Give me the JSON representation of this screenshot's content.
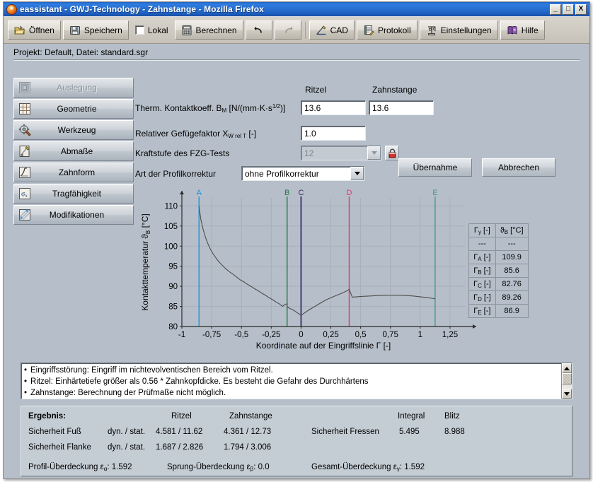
{
  "window": {
    "title": "eassistant - GWJ-Technology - Zahnstange - Mozilla Firefox",
    "app_icon": "firefox-icon",
    "minimize_label": "_",
    "maximize_label": "□",
    "close_label": "X"
  },
  "toolbar": {
    "items": [
      {
        "label": "Öffnen",
        "icon": "open-folder-icon"
      },
      {
        "label": "Speichern",
        "icon": "floppy-disk-icon"
      },
      {
        "label": "Lokal",
        "icon": "checkbox-icon",
        "checked": false
      },
      {
        "label": "Berechnen",
        "icon": "calculator-icon"
      },
      {
        "label": "",
        "icon": "undo-arrow-icon"
      },
      {
        "label": "",
        "icon": "redo-arrow-icon"
      },
      {
        "label": "CAD",
        "icon": "cad-pencil-icon"
      },
      {
        "label": "Protokoll",
        "icon": "report-icon"
      },
      {
        "label": "Einstellungen",
        "icon": "settings-tool-icon"
      },
      {
        "label": "Hilfe",
        "icon": "help-book-icon"
      }
    ]
  },
  "project_line": "Projekt: Default, Datei: standard.sgr",
  "sidebar": {
    "items": [
      {
        "label": "Auslegung",
        "icon": "layout-icon",
        "disabled": true
      },
      {
        "label": "Geometrie",
        "icon": "grid-icon",
        "disabled": false
      },
      {
        "label": "Werkzeug",
        "icon": "gear-tool-icon",
        "disabled": false
      },
      {
        "label": "Abmaße",
        "icon": "measure-icon",
        "disabled": false
      },
      {
        "label": "Zahnform",
        "icon": "tooth-profile-icon",
        "disabled": false
      },
      {
        "label": "Tragfähigkeit",
        "icon": "sigma-x-icon",
        "disabled": false
      },
      {
        "label": "Modifikationen",
        "icon": "modifications-icon",
        "disabled": false
      }
    ]
  },
  "form": {
    "col_headers": {
      "pinion": "Ritzel",
      "rack": "Zahnstange"
    },
    "rows": [
      {
        "label_main": "Therm. Kontaktkoeff. B",
        "label_sub": "M",
        "label_unit_pre": " [N/(mm·K·s",
        "label_sup": "1/2",
        "label_unit_post": ")]",
        "value_pinion": "13.6",
        "value_rack": "13.6"
      },
      {
        "label_main": "Relativer Gefügefaktor X",
        "label_sub": "W rel T",
        "label_unit_post": " [-]",
        "value_pinion": "1.0"
      },
      {
        "label_main": "Kraftstufe des FZG-Tests",
        "value_combo": "12",
        "disabled": true,
        "lock_icon": "padlock-icon"
      },
      {
        "label_main": "Art der Profilkorrektur",
        "value_combo": "ohne Profilkorrektur",
        "disabled": false
      }
    ],
    "buttons": {
      "apply": "Übernahme",
      "cancel": "Abbrechen"
    }
  },
  "chart_data": {
    "type": "line",
    "title": "",
    "xlabel": "Koordinate auf der Eingriffslinie Γ [-]",
    "ylabel": "Kontakttemperatur ϑ_B [°C]",
    "ylabel_main": "Kontakttemperatur ϑ",
    "ylabel_sub": "B",
    "ylabel_unit": " [°C]",
    "xlim": [
      -1,
      1.375
    ],
    "ylim": [
      80,
      112
    ],
    "xticks": [
      "-1",
      "-0,75",
      "-0,5",
      "-0,25",
      "0",
      "0,25",
      "0,5",
      "0,75",
      "1",
      "1,25"
    ],
    "xtick_values": [
      -1,
      -0.75,
      -0.5,
      -0.25,
      0,
      0.25,
      0.5,
      0.75,
      1,
      1.25
    ],
    "yticks": [
      "80",
      "85",
      "90",
      "95",
      "100",
      "105",
      "110"
    ],
    "ytick_values": [
      80,
      85,
      90,
      95,
      100,
      105,
      110
    ],
    "grid": true,
    "legend": "none",
    "line_color": "#4d4d4d",
    "markers": [
      {
        "name": "A",
        "x": -0.856,
        "color": "#1f8fd6"
      },
      {
        "name": "B",
        "x": -0.117,
        "color": "#1f7a44"
      },
      {
        "name": "C",
        "x": 0.0,
        "color": "#3b2a6b"
      },
      {
        "name": "D",
        "x": 0.404,
        "color": "#e8336e"
      },
      {
        "name": "E",
        "x": 1.125,
        "color": "#3f9a86"
      }
    ],
    "x": [
      -0.856,
      -0.84,
      -0.82,
      -0.8,
      -0.78,
      -0.76,
      -0.74,
      -0.72,
      -0.7,
      -0.68,
      -0.66,
      -0.64,
      -0.62,
      -0.6,
      -0.57,
      -0.54,
      -0.51,
      -0.48,
      -0.45,
      -0.42,
      -0.39,
      -0.36,
      -0.33,
      -0.3,
      -0.27,
      -0.24,
      -0.21,
      -0.18,
      -0.155,
      -0.14,
      -0.125,
      -0.117,
      -0.117,
      -0.1,
      -0.08,
      -0.06,
      -0.04,
      -0.02,
      0.0,
      0.0,
      0.03,
      0.07,
      0.11,
      0.15,
      0.19,
      0.23,
      0.27,
      0.31,
      0.35,
      0.38,
      0.404,
      0.404,
      0.43,
      0.47,
      0.52,
      0.58,
      0.64,
      0.7,
      0.76,
      0.82,
      0.88,
      0.94,
      1.0,
      1.06,
      1.125
    ],
    "y": [
      109.9,
      106.5,
      104.0,
      102.0,
      100.5,
      99.2,
      98.2,
      97.3,
      96.5,
      95.8,
      95.2,
      94.6,
      94.1,
      93.6,
      93.0,
      92.3,
      91.6,
      91.1,
      90.5,
      90.0,
      89.4,
      88.9,
      88.3,
      87.8,
      87.2,
      86.7,
      86.1,
      85.6,
      85.0,
      85.4,
      85.6,
      85.6,
      84.9,
      84.6,
      84.3,
      84.0,
      83.6,
      83.2,
      82.76,
      82.76,
      83.4,
      84.2,
      84.9,
      85.6,
      86.3,
      86.9,
      87.4,
      87.9,
      88.4,
      88.8,
      89.26,
      89.26,
      87.3,
      87.4,
      87.5,
      87.6,
      87.7,
      87.75,
      87.78,
      87.76,
      87.7,
      87.6,
      87.4,
      87.2,
      86.9
    ]
  },
  "gamma_table": {
    "headers": [
      "Γy [-]",
      "ϑB [°C]"
    ],
    "header_cells": [
      {
        "sym": "Γ",
        "sub": "y",
        "unit": " [-]"
      },
      {
        "sym": "ϑ",
        "sub": "B",
        "unit": " [°C]"
      }
    ],
    "rows": [
      {
        "label_sym": "",
        "label_sub": "",
        "label_unit": "---",
        "value": "---",
        "dash": true
      },
      {
        "label_sym": "Γ",
        "label_sub": "A",
        "label_unit": " [-]",
        "value": "109.9"
      },
      {
        "label_sym": "Γ",
        "label_sub": "B",
        "label_unit": " [-]",
        "value": "85.6"
      },
      {
        "label_sym": "Γ",
        "label_sub": "C",
        "label_unit": " [-]",
        "value": "82.76"
      },
      {
        "label_sym": "Γ",
        "label_sub": "D",
        "label_unit": " [-]",
        "value": "89.26"
      },
      {
        "label_sym": "Γ",
        "label_sub": "E",
        "label_unit": " [-]",
        "value": "86.9"
      }
    ]
  },
  "messages": {
    "items": [
      "Eingriffsstörung: Eingriff im nichtevolventischen Bereich vom Ritzel.",
      "Ritzel: Einhärtetiefe größer als 0.56 * Zahnkopfdicke. Es besteht die Gefahr des Durchhärtens",
      "Zahnstange: Berechnung der Prüfmaße nicht möglich."
    ],
    "scroll_up_icon": "scroll-up-icon",
    "scroll_down_icon": "scroll-down-icon"
  },
  "result": {
    "title": "Ergebnis:",
    "col_pinion": "Ritzel",
    "col_rack": "Zahnstange",
    "col_integral": "Integral",
    "col_blitz": "Blitz",
    "row_foot_label": "Sicherheit Fuß",
    "row_foot_mode": "dyn. / stat.",
    "row_foot_pinion": "4.581  / 11.62",
    "row_foot_rack": "4.361  / 12.73",
    "row_flank_label": "Sicherheit Flanke",
    "row_flank_mode": "dyn. / stat.",
    "row_flank_pinion": "1.687  / 2.826",
    "row_flank_rack": "1.794  / 3.006",
    "scuffing_label": "Sicherheit Fressen",
    "scuffing_integral": "5.495",
    "scuffing_blitz": "8.988",
    "overlap_profile_label": "Profil-Überdeckung ε",
    "overlap_profile_sub": "α",
    "overlap_profile_value": ": 1.592",
    "overlap_step_label": "Sprung-Überdeckung ε",
    "overlap_step_sub": "β",
    "overlap_step_value": ": 0.0",
    "overlap_total_label": "Gesamt-Überdeckung ε",
    "overlap_total_sub": "γ",
    "overlap_total_value": ": 1.592"
  }
}
